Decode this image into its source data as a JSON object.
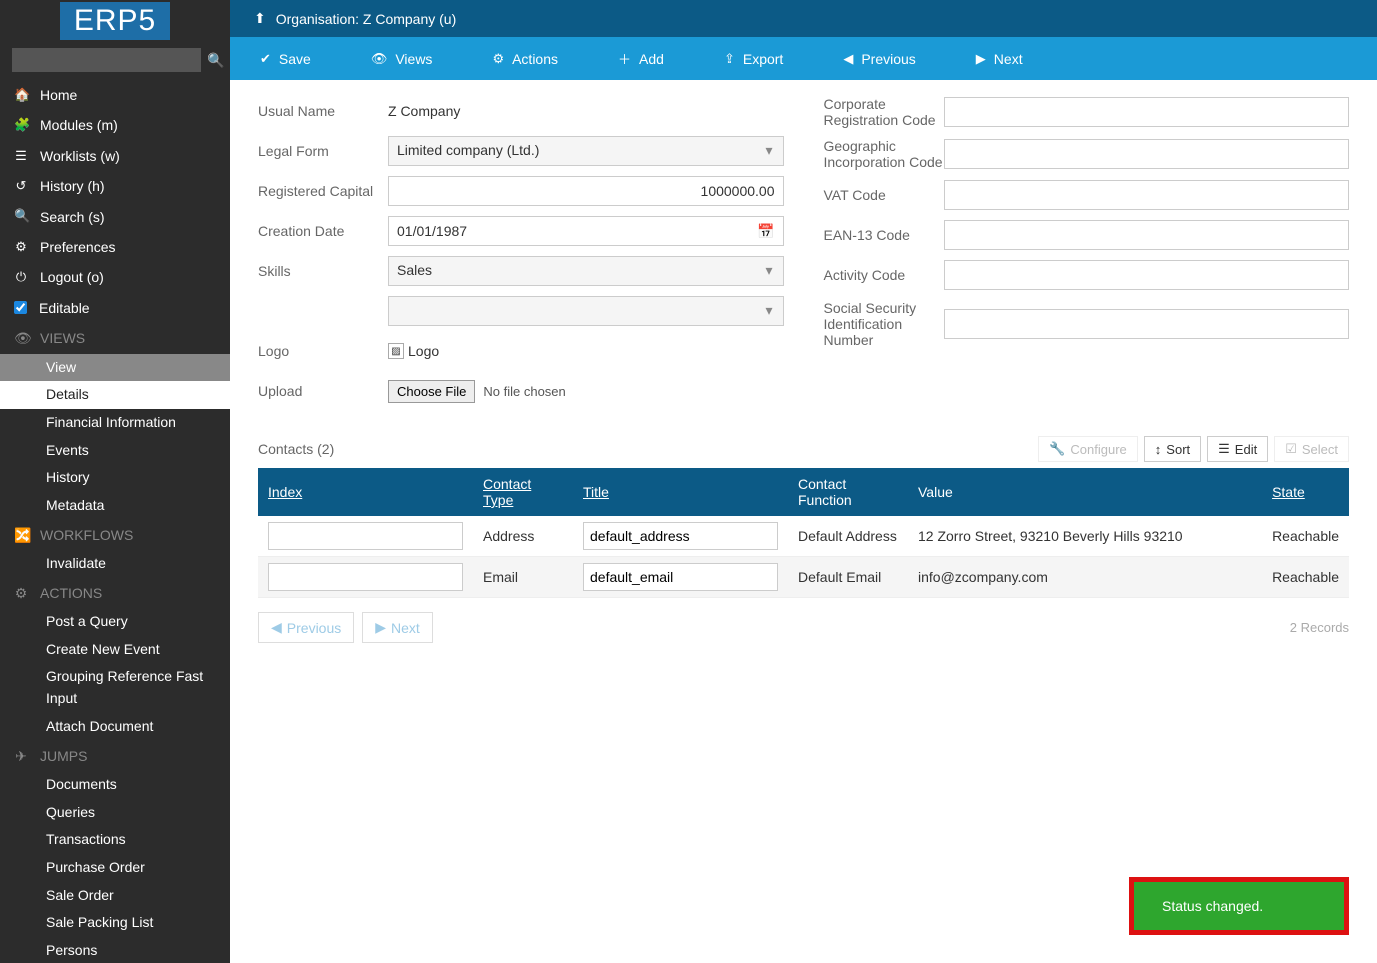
{
  "logo_text": "ERP5",
  "search": {
    "placeholder": ""
  },
  "nav": {
    "home": "Home",
    "modules": "Modules (m)",
    "worklists": "Worklists (w)",
    "history": "History (h)",
    "search": "Search (s)",
    "preferences": "Preferences",
    "logout": "Logout (o)",
    "editable": "Editable"
  },
  "sections": {
    "views_label": "VIEWS",
    "views": [
      "View",
      "Details",
      "Financial Information",
      "Events",
      "History",
      "Metadata"
    ],
    "workflows_label": "WORKFLOWS",
    "workflows": [
      "Invalidate"
    ],
    "actions_label": "ACTIONS",
    "actions": [
      "Post a Query",
      "Create New Event",
      "Grouping Reference Fast Input",
      "Attach Document"
    ],
    "jumps_label": "JUMPS",
    "jumps": [
      "Documents",
      "Queries",
      "Transactions",
      "Purchase Order",
      "Sale Order",
      "Sale Packing List",
      "Persons"
    ]
  },
  "breadcrumb": "Organisation: Z Company (u)",
  "toolbar": {
    "save": "Save",
    "views": "Views",
    "actions": "Actions",
    "add": "Add",
    "export": "Export",
    "previous": "Previous",
    "next": "Next"
  },
  "form": {
    "usual_name_label": "Usual Name",
    "usual_name_value": "Z Company",
    "legal_form_label": "Legal Form",
    "legal_form_value": "Limited company (Ltd.)",
    "registered_capital_label": "Registered Capital",
    "registered_capital_value": "1000000.00",
    "creation_date_label": "Creation Date",
    "creation_date_value": "01/01/1987",
    "skills_label": "Skills",
    "skills_value": "Sales",
    "skills_value_2": "",
    "logo_label": "Logo",
    "logo_alt": "Logo",
    "upload_label": "Upload",
    "choose_file": "Choose File",
    "no_file": "No file chosen",
    "corp_reg_label": "Corporate Registration Code",
    "geo_inc_label": "Geographic Incorporation Code",
    "vat_label": "VAT Code",
    "ean_label": "EAN-13 Code",
    "activity_label": "Activity Code",
    "ssn_label": "Social Security Identification Number"
  },
  "contacts": {
    "title": "Contacts (2)",
    "configure": "Configure",
    "sort": "Sort",
    "edit": "Edit",
    "select": "Select",
    "columns": {
      "index": "Index",
      "contact_type": "Contact Type",
      "title": "Title",
      "contact_function": "Contact Function",
      "value": "Value",
      "state": "State"
    },
    "rows": [
      {
        "index": "",
        "contact_type": "Address",
        "title": "default_address",
        "contact_function": "Default Address",
        "value": "12 Zorro Street, 93210 Beverly Hills 93210",
        "state": "Reachable"
      },
      {
        "index": "",
        "contact_type": "Email",
        "title": "default_email",
        "contact_function": "Default Email",
        "value": "info@zcompany.com",
        "state": "Reachable"
      }
    ],
    "pager_prev": "Previous",
    "pager_next": "Next",
    "records": "2 Records"
  },
  "toast": "Status changed."
}
